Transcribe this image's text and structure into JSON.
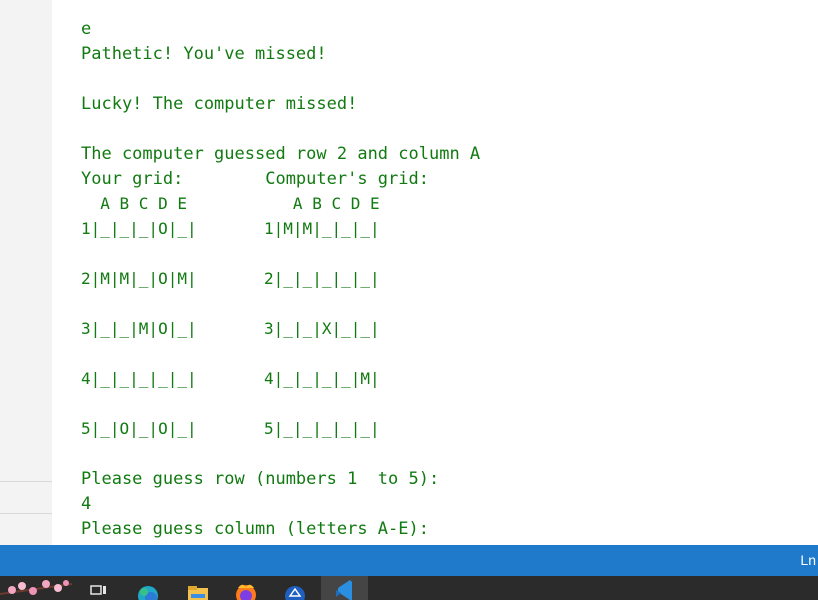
{
  "terminal": {
    "lines": [
      "e",
      "Pathetic! You've missed!",
      "",
      "Lucky! The computer missed!",
      "",
      "The computer guessed row 2 and column A",
      "Your grid:        Computer's grid:",
      "  A B C D E           A B C D E",
      "1|_|_|_|O|_|       1|M|M|_|_|_|",
      "",
      "2|M|M|_|O|M|       2|_|_|_|_|_|",
      "",
      "3|_|_|M|O|_|       3|_|_|X|_|_|",
      "",
      "4|_|_|_|_|_|       4|_|_|_|_|M|",
      "",
      "5|_|O|_|O|_|       5|_|_|_|_|_|",
      "",
      "Please guess row (numbers 1  to 5):",
      "4",
      "Please guess column (letters A-E):"
    ]
  },
  "status_bar": {
    "right_text": "Ln",
    "color": "#1f7acc"
  },
  "taskbar": {
    "icons": [
      "blossom-icon",
      "task-view-icon",
      "edge-icon",
      "file-explorer-icon",
      "firefox-icon",
      "app-icon",
      "vscode-icon"
    ],
    "active_icon": "vscode-icon",
    "color": "#2b2b2b"
  }
}
